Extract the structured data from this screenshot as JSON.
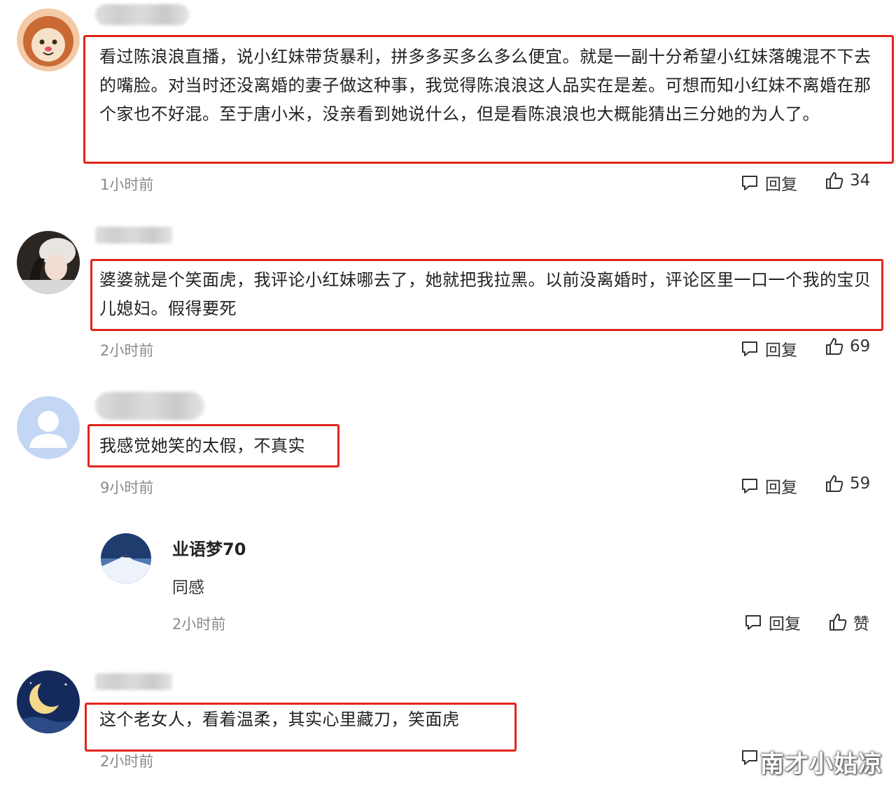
{
  "comments": [
    {
      "text": "看过陈浪浪直播，说小红妹带货暴利，拼多多买多么多么便宜。就是一副十分希望小红妹落魄混不下去的嘴脸。对当时还没离婚的妻子做这种事，我觉得陈浪浪这人品实在是差。可想而知小红妹不离婚在那个家也不好混。至于唐小米，没亲看到她说什么，但是看陈浪浪也大概能猜出三分她的为人了。",
      "time": "1小时前",
      "reply_label": "回复",
      "likes": "34",
      "avatar": "lion-avatar"
    },
    {
      "text": "婆婆就是个笑面虎，我评论小红妹哪去了，她就把我拉黑。以前没离婚时，评论区里一口一个我的宝贝儿媳妇。假得要死",
      "time": "2小时前",
      "reply_label": "回复",
      "likes": "69",
      "avatar": "girl-photo-avatar"
    },
    {
      "text": "我感觉她笑的太假，不真实",
      "time": "9小时前",
      "reply_label": "回复",
      "likes": "59",
      "avatar": "default-user-avatar",
      "reply": {
        "username": "业语梦70",
        "text": "同感",
        "time": "2小时前",
        "reply_label": "回复",
        "like_label": "赞",
        "avatar": "snow-mountain-avatar"
      }
    },
    {
      "text": "这个老女人，看着温柔，其实心里藏刀，笑面虎",
      "time": "2小时前",
      "avatar": "crescent-moon-avatar"
    }
  ],
  "watermark": "南才小姑凉",
  "colors": {
    "highlight": "#e1251b",
    "muted": "#8a8a8a"
  }
}
